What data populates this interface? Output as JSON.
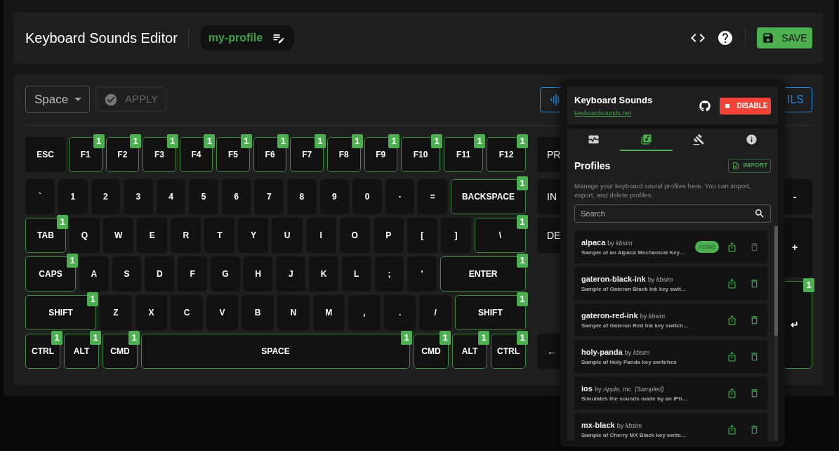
{
  "header": {
    "title": "Keyboard Sounds Editor",
    "profile_name": "my-profile",
    "save_label": "SAVE"
  },
  "toolbar": {
    "key_select": {
      "value": "Space"
    },
    "apply": {
      "label": "APPLY",
      "disabled": true
    },
    "cut_button_label": "ILS"
  },
  "keyboard": {
    "rows": [
      {
        "keys": [
          {
            "label": "ESC"
          },
          {
            "label": "F1",
            "badge": "1"
          },
          {
            "label": "F2",
            "badge": "1"
          },
          {
            "label": "F3",
            "badge": "1"
          },
          {
            "label": "F4",
            "badge": "1"
          },
          {
            "label": "F5",
            "badge": "1"
          },
          {
            "label": "F6",
            "badge": "1"
          },
          {
            "label": "F7",
            "badge": "1"
          },
          {
            "label": "F8",
            "badge": "1"
          },
          {
            "label": "F9",
            "badge": "1"
          },
          {
            "label": "F10",
            "badge": "1"
          },
          {
            "label": "F11",
            "badge": "1"
          },
          {
            "label": "F12",
            "badge": "1"
          }
        ],
        "side_key": {
          "label": "PR"
        }
      },
      {
        "keys": [
          {
            "label": "`"
          },
          {
            "label": "1"
          },
          {
            "label": "2"
          },
          {
            "label": "3"
          },
          {
            "label": "4"
          },
          {
            "label": "5"
          },
          {
            "label": "6"
          },
          {
            "label": "7"
          },
          {
            "label": "8"
          },
          {
            "label": "9"
          },
          {
            "label": "0"
          },
          {
            "label": "-"
          },
          {
            "label": "="
          },
          {
            "label": "BACKSPACE",
            "badge": "1"
          }
        ],
        "side_key": {
          "label": "IN"
        }
      },
      {
        "keys": [
          {
            "label": "TAB",
            "badge": "1"
          },
          {
            "label": "Q"
          },
          {
            "label": "W"
          },
          {
            "label": "E"
          },
          {
            "label": "R"
          },
          {
            "label": "T"
          },
          {
            "label": "Y"
          },
          {
            "label": "U"
          },
          {
            "label": "I"
          },
          {
            "label": "O"
          },
          {
            "label": "P"
          },
          {
            "label": "["
          },
          {
            "label": "]"
          },
          {
            "label": "\\",
            "badge": "1"
          }
        ],
        "side_key": {
          "label": "DE"
        }
      },
      {
        "keys": [
          {
            "label": "CAPS",
            "badge": "1"
          },
          {
            "label": "A"
          },
          {
            "label": "S"
          },
          {
            "label": "D"
          },
          {
            "label": "F"
          },
          {
            "label": "G"
          },
          {
            "label": "H"
          },
          {
            "label": "J"
          },
          {
            "label": "K"
          },
          {
            "label": "L"
          },
          {
            "label": ";"
          },
          {
            "label": "'"
          },
          {
            "label": "ENTER",
            "badge": "1"
          }
        ]
      },
      {
        "keys": [
          {
            "label": "SHIFT",
            "badge": "1"
          },
          {
            "label": "Z"
          },
          {
            "label": "X"
          },
          {
            "label": "C"
          },
          {
            "label": "V"
          },
          {
            "label": "B"
          },
          {
            "label": "N"
          },
          {
            "label": "M"
          },
          {
            "label": ","
          },
          {
            "label": "."
          },
          {
            "label": "/"
          },
          {
            "label": "SHIFT",
            "badge": "1"
          }
        ]
      },
      {
        "keys": [
          {
            "label": "CTRL",
            "badge": "1"
          },
          {
            "label": "ALT",
            "badge": "1"
          },
          {
            "label": "CMD",
            "badge": "1"
          },
          {
            "label": "SPACE",
            "badge": "1"
          },
          {
            "label": "CMD",
            "badge": "1"
          },
          {
            "label": "ALT",
            "badge": "1"
          },
          {
            "label": "CTRL",
            "badge": "1"
          }
        ],
        "side_key": {
          "label": "←"
        }
      }
    ],
    "numpad_keys": [
      {
        "label": "-"
      },
      {
        "label": "+"
      },
      {
        "label": "↵",
        "badge": "1"
      }
    ]
  },
  "popup": {
    "title": "Keyboard Sounds",
    "link": "keyboardsounds.net",
    "disable_label": "DISABLE",
    "tabs": [
      {
        "selected": false
      },
      {
        "selected": true
      },
      {
        "selected": false
      },
      {
        "selected": false
      }
    ],
    "section_title": "Profiles",
    "import_label": "IMPORT",
    "description": "Manage your keyboard sound profiles here. You can import, export, and delete profiles.",
    "search": {
      "placeholder": "Search"
    },
    "profiles": [
      {
        "name": "alpaca",
        "byline": "by *kbsim*",
        "description": "Sample of an Alpaca Mechanical Key…",
        "status": "Active",
        "delete_disabled": true
      },
      {
        "name": "gateron-black-ink",
        "byline": "by *kbsim*",
        "description": "Sample of Gateron Black Ink key swit…",
        "delete_disabled": false
      },
      {
        "name": "gateron-red-ink",
        "byline": "by *kbsim*",
        "description": "Sample of Gateron Red Ink key switch…",
        "delete_disabled": false
      },
      {
        "name": "holy-panda",
        "byline": "by *kbsim*",
        "description": "Sample of Holy Panda key switches",
        "delete_disabled": false
      },
      {
        "name": "ios",
        "byline": "by *Apple, Inc. (Sampled)*",
        "description": "Simulates the sounds made by an iPh…",
        "delete_disabled": false
      },
      {
        "name": "mx-black",
        "byline": "by *kbsim*",
        "description": "Sample of Cherry MX Black key switc…",
        "delete_disabled": false
      }
    ]
  }
}
